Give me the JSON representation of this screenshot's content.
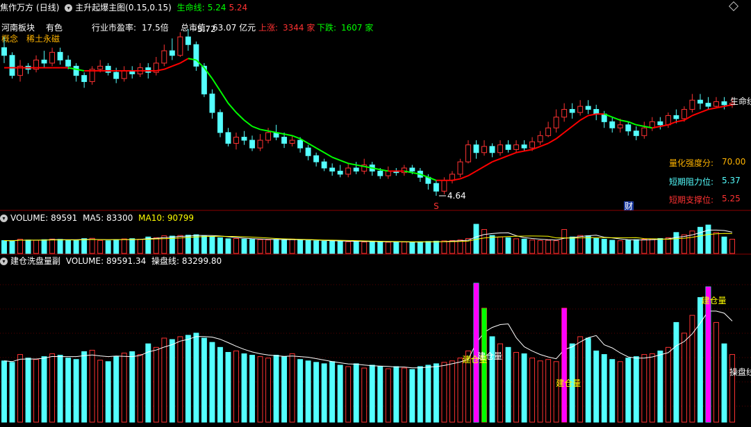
{
  "window": {
    "stock_name": "焦作万方",
    "period": "(日线)",
    "indicator": "主升起爆主图(0.15,0.15)",
    "life_line_label": "生命线:",
    "life_line_value1": "5.24",
    "life_line_value2": "5.24"
  },
  "info": {
    "region": "河南板块",
    "sector": "有色",
    "pe_label": "行业市盈率:",
    "pe_value": "17.5倍",
    "mcap_label": "总市值:",
    "mcap_value": "63.07 亿元",
    "up_label": "上涨:",
    "up_value": "3344 家",
    "down_label": "下跌:",
    "down_value": "1607 家",
    "concept_label": "概念",
    "concept_value": "稀土永磁"
  },
  "price_labels": {
    "high": "5.72",
    "low": "4.64",
    "life_line_tag": "生命线",
    "marker_s": "S",
    "marker_cai": "财"
  },
  "stats": {
    "strength_label": "量化强度分:",
    "strength_value": "70.00",
    "resistance_label": "短期阻力位:",
    "resistance_value": "5.37",
    "support_label": "短期支撑位:",
    "support_value": "5.25"
  },
  "volume_panel": {
    "label": "VOLUME: 89591",
    "ma5": "MA5: 83300",
    "ma10": "MA10: 90799"
  },
  "accum_panel": {
    "label": "建仓洗盘量副",
    "volume": "VOLUME: 89591.34",
    "ctrl_line": "操盘线: 83299.80",
    "tag_build": "建仓量",
    "tag_ctrl": "操盘线"
  },
  "colors": {
    "up": "#ff3232",
    "down": "#54ffff",
    "life_green": "#00ff00",
    "life_red": "#ff0000",
    "magenta": "#ff00ff",
    "yellow": "#ffff00",
    "orange": "#ffb400"
  },
  "chart_data": [
    {
      "type": "candlestick",
      "title": "焦作万方 (日线)",
      "annotations": [
        "5.72",
        "4.64"
      ],
      "candles": [
        [
          5.6,
          5.55,
          5.67,
          5.5
        ],
        [
          5.55,
          5.42,
          5.57,
          5.4
        ],
        [
          5.42,
          5.48,
          5.52,
          5.38
        ],
        [
          5.48,
          5.46,
          5.5,
          5.43
        ],
        [
          5.46,
          5.52,
          5.55,
          5.44
        ],
        [
          5.52,
          5.5,
          5.58,
          5.47
        ],
        [
          5.5,
          5.57,
          5.6,
          5.48
        ],
        [
          5.57,
          5.52,
          5.6,
          5.49
        ],
        [
          5.52,
          5.48,
          5.55,
          5.46
        ],
        [
          5.48,
          5.42,
          5.5,
          5.38
        ],
        [
          5.42,
          5.38,
          5.44,
          5.34
        ],
        [
          5.38,
          5.46,
          5.48,
          5.36
        ],
        [
          5.46,
          5.48,
          5.52,
          5.44
        ],
        [
          5.48,
          5.44,
          5.5,
          5.42
        ],
        [
          5.44,
          5.4,
          5.47,
          5.37
        ],
        [
          5.4,
          5.45,
          5.48,
          5.38
        ],
        [
          5.45,
          5.43,
          5.48,
          5.4
        ],
        [
          5.43,
          5.47,
          5.5,
          5.41
        ],
        [
          5.47,
          5.44,
          5.5,
          5.4
        ],
        [
          5.44,
          5.5,
          5.54,
          5.42
        ],
        [
          5.5,
          5.58,
          5.62,
          5.48
        ],
        [
          5.58,
          5.55,
          5.66,
          5.52
        ],
        [
          5.55,
          5.67,
          5.7,
          5.54
        ],
        [
          5.67,
          5.62,
          5.72,
          5.58
        ],
        [
          5.62,
          5.48,
          5.64,
          5.45
        ],
        [
          5.48,
          5.3,
          5.5,
          5.28
        ],
        [
          5.3,
          5.18,
          5.33,
          5.14
        ],
        [
          5.18,
          5.05,
          5.2,
          5.02
        ],
        [
          5.05,
          4.98,
          5.08,
          4.96
        ],
        [
          4.98,
          5.02,
          5.05,
          4.94
        ],
        [
          5.02,
          5.0,
          5.06,
          4.97
        ],
        [
          5.0,
          4.95,
          5.03,
          4.93
        ],
        [
          4.95,
          5.0,
          5.04,
          4.93
        ],
        [
          5.0,
          5.05,
          5.08,
          4.98
        ],
        [
          5.05,
          5.02,
          5.1,
          5.0
        ],
        [
          5.02,
          4.98,
          5.05,
          4.95
        ],
        [
          4.98,
          5.0,
          5.03,
          4.96
        ],
        [
          5.0,
          4.95,
          5.02,
          4.92
        ],
        [
          4.95,
          4.9,
          4.97,
          4.87
        ],
        [
          4.9,
          4.86,
          4.92,
          4.83
        ],
        [
          4.86,
          4.82,
          4.88,
          4.8
        ],
        [
          4.82,
          4.8,
          4.85,
          4.77
        ],
        [
          4.8,
          4.78,
          4.84,
          4.76
        ],
        [
          4.78,
          4.82,
          4.85,
          4.76
        ],
        [
          4.82,
          4.8,
          4.86,
          4.78
        ],
        [
          4.8,
          4.84,
          4.88,
          4.78
        ],
        [
          4.84,
          4.8,
          4.86,
          4.77
        ],
        [
          4.8,
          4.77,
          4.82,
          4.75
        ],
        [
          4.77,
          4.8,
          4.83,
          4.75
        ],
        [
          4.8,
          4.79,
          4.82,
          4.77
        ],
        [
          4.79,
          4.82,
          4.84,
          4.77
        ],
        [
          4.82,
          4.8,
          4.84,
          4.78
        ],
        [
          4.8,
          4.76,
          4.82,
          4.73
        ],
        [
          4.76,
          4.72,
          4.78,
          4.68
        ],
        [
          4.72,
          4.67,
          4.74,
          4.64
        ],
        [
          4.67,
          4.74,
          4.76,
          4.65
        ],
        [
          4.74,
          4.78,
          4.8,
          4.72
        ],
        [
          4.78,
          4.86,
          4.88,
          4.76
        ],
        [
          4.86,
          4.97,
          5.0,
          4.85
        ],
        [
          4.97,
          4.92,
          5.0,
          4.88
        ],
        [
          4.92,
          4.96,
          5.0,
          4.9
        ],
        [
          4.96,
          4.92,
          4.98,
          4.89
        ],
        [
          4.92,
          4.97,
          5.0,
          4.9
        ],
        [
          4.97,
          4.94,
          5.0,
          4.92
        ],
        [
          4.94,
          4.97,
          5.0,
          4.92
        ],
        [
          4.97,
          4.95,
          5.0,
          4.93
        ],
        [
          4.95,
          4.99,
          5.02,
          4.93
        ],
        [
          4.99,
          5.03,
          5.06,
          4.97
        ],
        [
          5.03,
          5.08,
          5.12,
          5.02
        ],
        [
          5.08,
          5.15,
          5.2,
          5.05
        ],
        [
          5.15,
          5.2,
          5.24,
          5.12
        ],
        [
          5.2,
          5.18,
          5.24,
          5.14
        ],
        [
          5.18,
          5.22,
          5.26,
          5.16
        ],
        [
          5.22,
          5.2,
          5.26,
          5.17
        ],
        [
          5.2,
          5.17,
          5.23,
          5.13
        ],
        [
          5.17,
          5.12,
          5.19,
          5.08
        ],
        [
          5.12,
          5.08,
          5.15,
          5.05
        ],
        [
          5.08,
          5.1,
          5.14,
          5.05
        ],
        [
          5.1,
          5.06,
          5.12,
          5.03
        ],
        [
          5.06,
          5.03,
          5.09,
          5.0
        ],
        [
          5.03,
          5.08,
          5.12,
          5.01
        ],
        [
          5.08,
          5.12,
          5.15,
          5.06
        ],
        [
          5.12,
          5.1,
          5.15,
          5.07
        ],
        [
          5.1,
          5.16,
          5.18,
          5.08
        ],
        [
          5.16,
          5.14,
          5.2,
          5.11
        ],
        [
          5.14,
          5.2,
          5.22,
          5.12
        ],
        [
          5.2,
          5.26,
          5.3,
          5.18
        ],
        [
          5.26,
          5.24,
          5.3,
          5.2
        ],
        [
          5.24,
          5.22,
          5.28,
          5.2
        ],
        [
          5.22,
          5.25,
          5.28,
          5.21
        ],
        [
          5.25,
          5.23,
          5.28,
          5.2
        ],
        [
          5.23,
          5.24,
          5.28,
          5.21
        ]
      ],
      "life_line": [
        5.47,
        5.47,
        5.47,
        5.47,
        5.47,
        5.47,
        5.47,
        5.47,
        5.47,
        5.46,
        5.45,
        5.45,
        5.45,
        5.45,
        5.45,
        5.45,
        5.45,
        5.45,
        5.45,
        5.45,
        5.46,
        5.48,
        5.5,
        5.53,
        5.52,
        5.47,
        5.4,
        5.32,
        5.24,
        5.18,
        5.13,
        5.09,
        5.07,
        5.06,
        5.05,
        5.04,
        5.03,
        5.01,
        4.98,
        4.95,
        4.92,
        4.89,
        4.87,
        4.85,
        4.84,
        4.83,
        4.82,
        4.81,
        4.8,
        4.8,
        4.8,
        4.79,
        4.78,
        4.76,
        4.74,
        4.74,
        4.74,
        4.75,
        4.77,
        4.8,
        4.83,
        4.86,
        4.88,
        4.9,
        4.92,
        4.93,
        4.94,
        4.96,
        4.98,
        5.01,
        5.05,
        5.09,
        5.13,
        5.16,
        5.17,
        5.17,
        5.15,
        5.13,
        5.12,
        5.1,
        5.09,
        5.08,
        5.09,
        5.1,
        5.12,
        5.13,
        5.16,
        5.18,
        5.2,
        5.21,
        5.22,
        5.23
      ]
    },
    {
      "type": "bar",
      "title": "VOLUME",
      "series": [
        {
          "name": "VOLUME",
          "values": [
            86000,
            84000,
            95000,
            90000,
            88000,
            92000,
            96000,
            94000,
            90000,
            88000,
            99000,
            101000,
            87000,
            85000,
            92000,
            97000,
            99000,
            95000,
            110000,
            105000,
            118000,
            116000,
            120000,
            122000,
            125000,
            118000,
            112000,
            105000,
            98000,
            100000,
            96000,
            94000,
            92000,
            90000,
            94000,
            92000,
            96000,
            88000,
            86000,
            84000,
            82000,
            85000,
            80000,
            78000,
            82000,
            76000,
            80000,
            78000,
            75000,
            78000,
            76000,
            74000,
            78000,
            80000,
            82000,
            84000,
            86000,
            90000,
            100000,
            195000,
            160000,
            120000,
            110000,
            105000,
            98000,
            96000,
            90000,
            86000,
            88000,
            85000,
            160000,
            110000,
            120000,
            118000,
            100000,
            95000,
            88000,
            85000,
            90000,
            92000,
            95000,
            96000,
            100000,
            105000,
            140000,
            125000,
            150000,
            175000,
            190000,
            140000,
            110000,
            95000
          ]
        },
        {
          "name": "MA5",
          "values": []
        },
        {
          "name": "MA10",
          "values": []
        }
      ]
    },
    {
      "type": "bar",
      "title": "建仓洗盘量副",
      "series": [
        {
          "name": "VOLUME",
          "values": []
        },
        {
          "name": "操盘线",
          "values": []
        }
      ],
      "annotations": [
        "建仓量",
        "操盘线"
      ]
    }
  ]
}
